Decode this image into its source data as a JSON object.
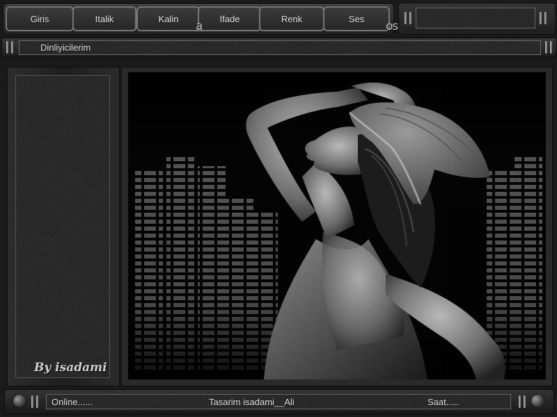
{
  "toolbar": {
    "tabs": [
      {
        "label": "Giris"
      },
      {
        "label": "Italik"
      },
      {
        "label": "Kalin"
      },
      {
        "label": "Ifade"
      },
      {
        "label": "Renk"
      },
      {
        "label": "Ses"
      }
    ],
    "a_glyph": "a",
    "os_glyph": "os"
  },
  "listeners_bar": {
    "label": "Dinliyicilerim"
  },
  "left_panel": {
    "signature": "By isadami"
  },
  "status_bar": {
    "online": "Online......",
    "credit": "Tasarim  isadami__Ali",
    "clock": "Saat....."
  },
  "colors": {
    "background": "#1a1a1a",
    "panel": "#2a2a2a",
    "text": "#d8d8d8",
    "border_light": "#777777"
  }
}
